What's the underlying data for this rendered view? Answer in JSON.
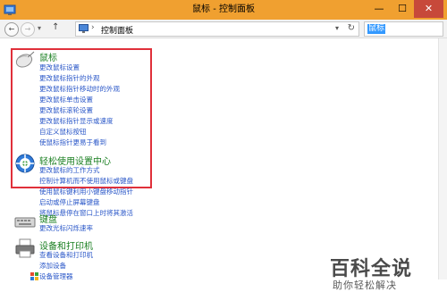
{
  "window": {
    "title": "鼠标 - 控制面板",
    "min_glyph": "—",
    "max_glyph": "☐",
    "close_glyph": "✕"
  },
  "address_bar": {
    "back_glyph": "←",
    "forward_glyph": "→",
    "recent_glyph": "▾",
    "up_glyph": "↑",
    "separator": "›",
    "path": "控制面板",
    "dropdown_glyph": "▾",
    "refresh_glyph": "↻",
    "search_value": "鼠标"
  },
  "categories": [
    {
      "name": "mouse",
      "icon": "mouse-icon",
      "title": "鼠标",
      "links": [
        "更改鼠标设置",
        "更改鼠标指针的外观",
        "更改鼠标指针移动时的外观",
        "更改鼠标单击设置",
        "更改鼠标滚轮设置",
        "更改鼠标指针显示或速度",
        "自定义鼠标按钮",
        "使鼠标指针更易于看到"
      ]
    },
    {
      "name": "ease-of-access",
      "icon": "ease-of-access-icon",
      "title": "轻松使用设置中心",
      "links": [
        "更改鼠标的工作方式",
        "控制计算机而不使用鼠标或键盘",
        "使用鼠标键利用小键盘移动指针",
        "启动或停止屏幕键盘",
        "将鼠标悬停在窗口上时将其激活"
      ]
    },
    {
      "name": "keyboard",
      "icon": "keyboard-icon",
      "title": "键盘",
      "links": [
        "更改光标闪烁速率"
      ]
    },
    {
      "name": "devices-printers",
      "icon": "printer-icon",
      "title": "设备和打印机",
      "links": [
        "查看设备和打印机",
        "添加设备",
        "设备管理器"
      ]
    }
  ],
  "watermark": {
    "title": "百科全说",
    "subtitle": "助你轻松解决"
  },
  "colors": {
    "titlebar": "#f0a030",
    "category_title": "#1a7f21",
    "link": "#2a57c8",
    "highlight_box": "#e0303a",
    "close_button": "#c7493a"
  }
}
